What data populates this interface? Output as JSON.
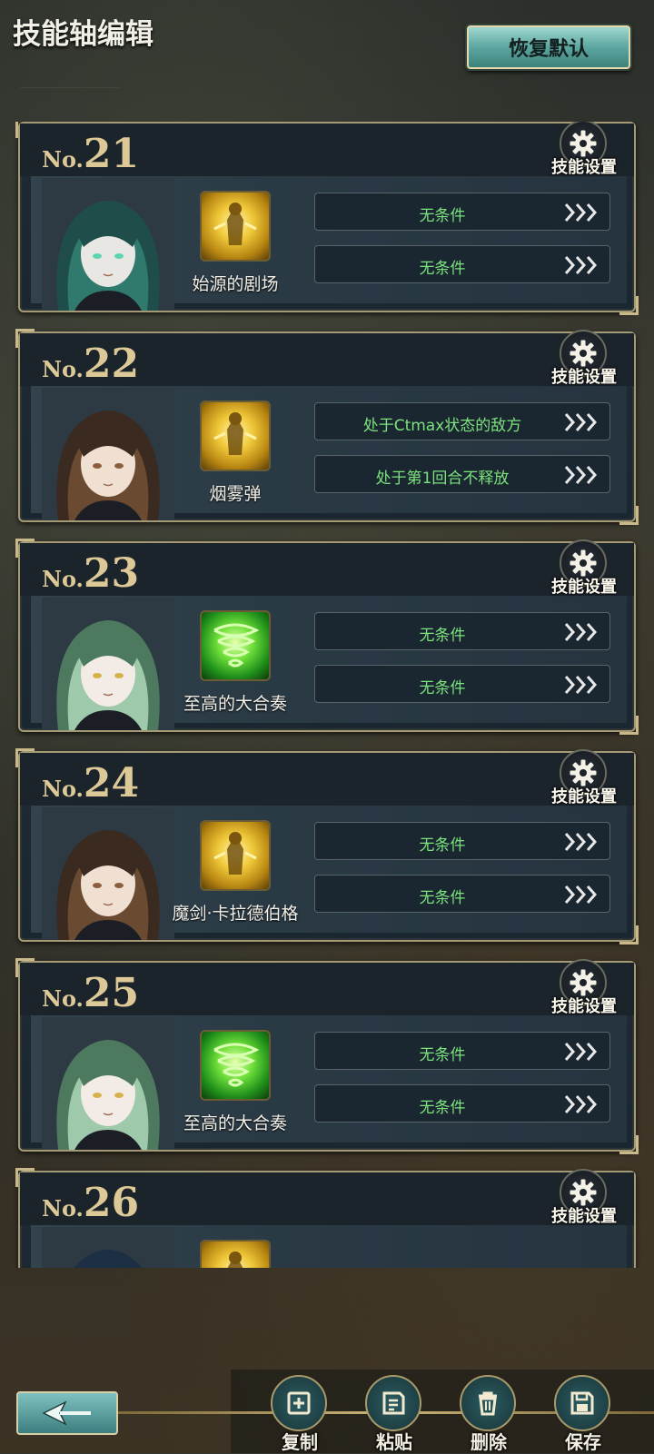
{
  "header": {
    "title": "技能轴编辑",
    "reset_label": "恢复默认"
  },
  "gear_label": "技能设置",
  "cards": [
    {
      "no_prefix": "No.",
      "no": "21",
      "portrait": "teal-hair-character",
      "icon": "gold",
      "skill": "始源的剧场",
      "conditions": [
        "无条件",
        "无条件"
      ]
    },
    {
      "no_prefix": "No.",
      "no": "22",
      "portrait": "brown-hair-character",
      "icon": "gold",
      "skill": "烟雾弹",
      "conditions": [
        "处于Ctmax状态的敌方",
        "处于第1回合不释放"
      ]
    },
    {
      "no_prefix": "No.",
      "no": "23",
      "portrait": "mint-hair-character",
      "icon": "green",
      "skill": "至高的大合奏",
      "conditions": [
        "无条件",
        "无条件"
      ]
    },
    {
      "no_prefix": "No.",
      "no": "24",
      "portrait": "brown-hair-character",
      "icon": "gold",
      "skill": "魔剑·卡拉德伯格",
      "conditions": [
        "无条件",
        "无条件"
      ]
    },
    {
      "no_prefix": "No.",
      "no": "25",
      "portrait": "mint-hair-character",
      "icon": "green",
      "skill": "至高的大合奏",
      "conditions": [
        "无条件",
        "无条件"
      ]
    },
    {
      "no_prefix": "No.",
      "no": "26",
      "portrait": "dark-blue-hair-character",
      "icon": "gold",
      "skill": "",
      "conditions": []
    }
  ],
  "actions": {
    "copy": "复制",
    "paste": "粘贴",
    "delete": "删除",
    "save": "保存"
  }
}
